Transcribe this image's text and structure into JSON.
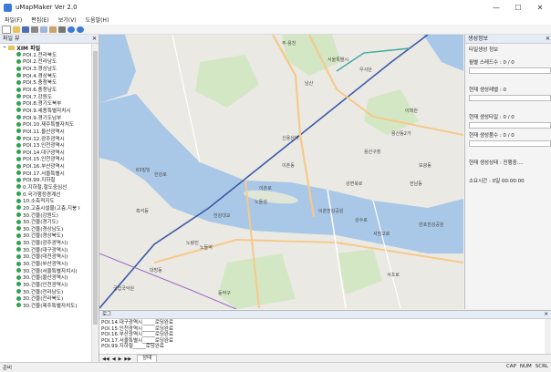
{
  "app": {
    "title": "uMapMaker Ver 2.0"
  },
  "window_controls": {
    "minimize": "—",
    "maximize": "☐",
    "close": "✕"
  },
  "menu": [
    "파일(F)",
    "편집(E)",
    "보기(V)",
    "도움말(H)"
  ],
  "toolbar_icons": [
    "new-icon",
    "open-icon",
    "save-icon",
    "cut-icon",
    "copy-icon",
    "paste-icon",
    "print-icon",
    "info-icon",
    "help-icon"
  ],
  "left_panel": {
    "title": "파일 뷰",
    "close": "✕",
    "root": "XIM 파일",
    "items": [
      "POI.1.전라북도",
      "POI.2.전라남도",
      "POI.3.경상남도",
      "POI.4.경상북도",
      "POI.5.충청북도",
      "POI.6.충청남도",
      "POI.7.강원도",
      "POI.8.경기도북부",
      "POI.9.세종특별자치시",
      "POI.9.경기도남부",
      "POI.10.제주특별자치도",
      "POI.11.울산광역시",
      "POI.12.광주광역시",
      "POI.13.인천광역시",
      "POI.14.대구광역시",
      "POI.15.인천광역시",
      "POI.16.부산광역시",
      "POI.17.서울특별시",
      "POI.99.지하철",
      "0.지하철,철도중심선",
      "0.국가행정경계선",
      "10.소축적지도",
      "20.고층시설물(고층,지붕 I",
      "30.건물(강원도)",
      "30.건물(경기도)",
      "30.건물(경상남도)",
      "30.건물(경상북도)",
      "30.건물(광주광역시)",
      "30.건물(대구광역시)",
      "30.건물(대전광역시)",
      "30.건물(부산광역시)",
      "30.건물(서울특별자치시)",
      "30.건물(울산광역시)",
      "30.건물(인천광역시)",
      "30.건물(전라남도)",
      "30.건물(전라북도)",
      "30.건물(제주특별자치도)"
    ]
  },
  "map": {
    "labels": [
      "주·용천",
      "남산",
      "서울특별시",
      "우사단",
      "용산동2가",
      "이촌로",
      "이촌동",
      "용산구청",
      "한강로",
      "노량진",
      "강변북로",
      "63빌딩",
      "국립국악원",
      "성수로",
      "대방동",
      "한남동",
      "서빙고로",
      "동작구",
      "이태원",
      "보광동",
      "흑석동",
      "서초로",
      "한강대교",
      "신용산역",
      "이촌한강공원",
      "반포한강공원",
      "노들섬",
      "노들역"
    ]
  },
  "right_panel": {
    "title": "생성정보",
    "close": "✕",
    "group_title": "타일생성 정보",
    "rows": [
      {
        "label": "월별 스레드수 : 0 / 0",
        "progress": 0
      },
      {
        "label": "현재 생성레벨 : 0",
        "progress": 0
      },
      {
        "label": "현재 생성타일 : 0 / 0",
        "progress": 0
      },
      {
        "label": "현재 생성품수 : 0 / 0",
        "progress": 0
      },
      {
        "label": "현재 생성상태 : 진행중....",
        "progress": 0
      }
    ],
    "elapsed": "소요시간 : 0일 00:00:00"
  },
  "log_panel": {
    "title": "로그",
    "close": "✕",
    "lines": [
      "POI.14.대구광역시_____로딩완료",
      "POI.15.인천광역시_____로딩완료",
      "POI.16.부산광역시_____로딩완료",
      "POI.17.서울특별시_____로딩완료",
      "POI.99.지하철_____로딩완료"
    ],
    "tab": "상태",
    "nav": [
      "◀◀",
      "◀",
      "▶",
      "▶▶"
    ]
  },
  "status_bar": {
    "left": "준비",
    "indicators": [
      "CAP",
      "NUM",
      "SCRL"
    ]
  },
  "colors": {
    "water": "#a9c7e6",
    "river": "#9cc0e4",
    "park": "#d4e7c4",
    "road": "#f5c98a",
    "dot": "#31a24c"
  }
}
